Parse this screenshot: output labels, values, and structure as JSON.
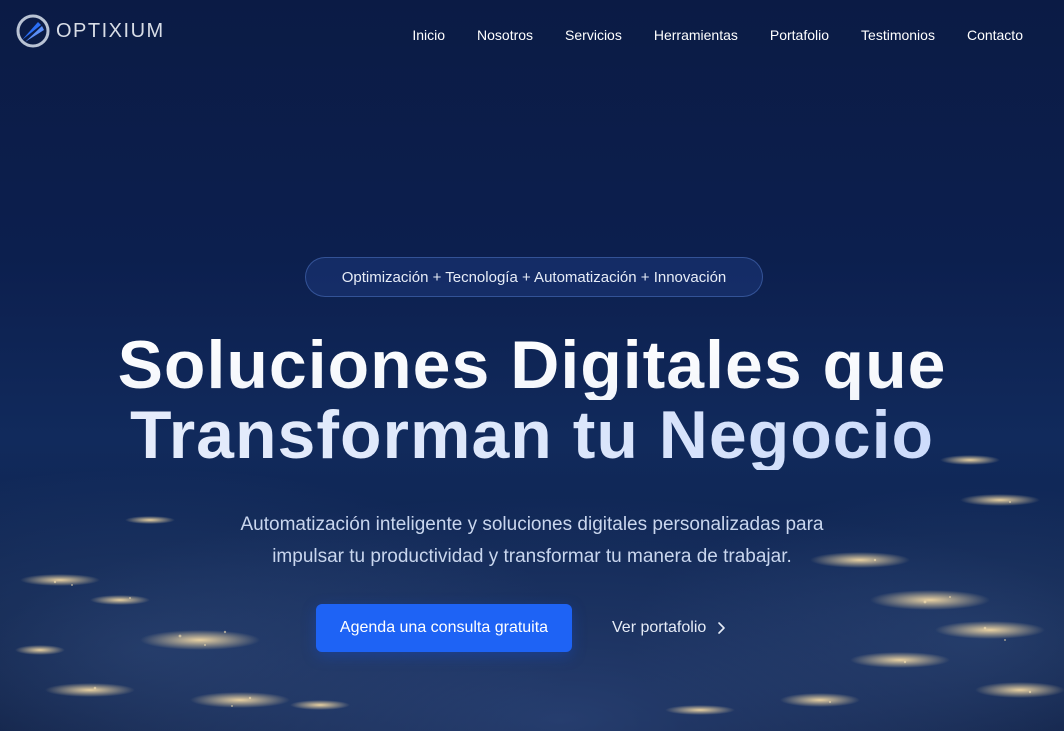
{
  "brand": {
    "name": "OPTIXIUM",
    "logo_icon": "optixium-logo-icon"
  },
  "nav": {
    "items": [
      {
        "label": "Inicio"
      },
      {
        "label": "Nosotros"
      },
      {
        "label": "Servicios"
      },
      {
        "label": "Herramientas"
      },
      {
        "label": "Portafolio"
      },
      {
        "label": "Testimonios"
      },
      {
        "label": "Contacto"
      }
    ]
  },
  "hero": {
    "tagline": "Optimización + Tecnología + Automatización + Innovación",
    "headline_line1": "Soluciones Digitales que",
    "headline_line2": "Transforman tu Negocio",
    "subtitle_line1": "Automatización inteligente y soluciones digitales personalizadas para",
    "subtitle_line2": "impulsar tu productividad y transformar tu manera de trabajar.",
    "cta_primary": "Agenda una consulta gratuita",
    "cta_secondary": "Ver portafolio",
    "cta_secondary_icon": "chevron-right-icon"
  },
  "colors": {
    "background": "#0c1f4e",
    "accent": "#1e63f5",
    "text": "#ffffff",
    "subtitle": "#c9d6ee"
  }
}
